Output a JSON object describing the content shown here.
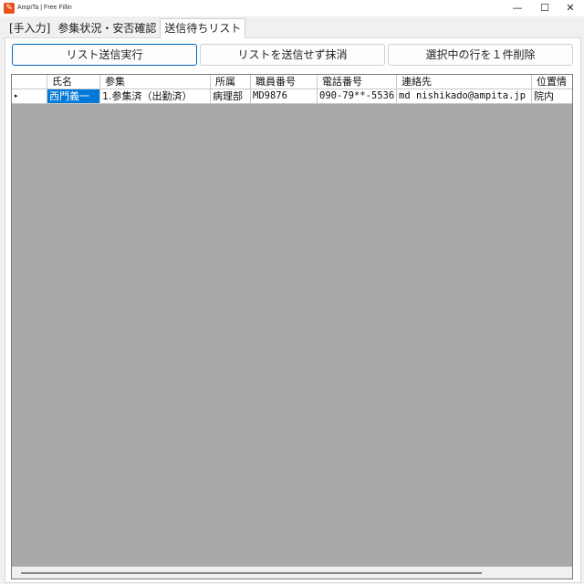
{
  "window": {
    "title": "AmpiTa | Free Fillin",
    "icon": "app-logo-icon",
    "controls": {
      "minimize": "—",
      "maximize": "☐",
      "close": "✕"
    }
  },
  "tabs": [
    {
      "label": "[手入力]",
      "active": false
    },
    {
      "label": "参集状況・安否確認",
      "active": false
    },
    {
      "label": "送信待ちリスト",
      "active": true
    }
  ],
  "toolbar": {
    "send_label": "リスト送信実行",
    "discard_label": "リストを送信せず抹消",
    "delete_label": "選択中の行を１件削除"
  },
  "grid": {
    "columns": [
      "氏名",
      "参集",
      "所属",
      "職員番号",
      "電話番号",
      "連絡先",
      "位置情"
    ],
    "rows": [
      {
        "indicator": "▸",
        "cells": [
          "西門義一",
          "1.参集済（出勤済）",
          "病理部",
          "MD9876",
          "090-79**-5536",
          "md nishikado@ampita.jp",
          "院内"
        ]
      }
    ]
  },
  "colors": {
    "selection": "#0078d7",
    "primary_border": "#0067c0",
    "grid_background": "#a9a9a9"
  }
}
